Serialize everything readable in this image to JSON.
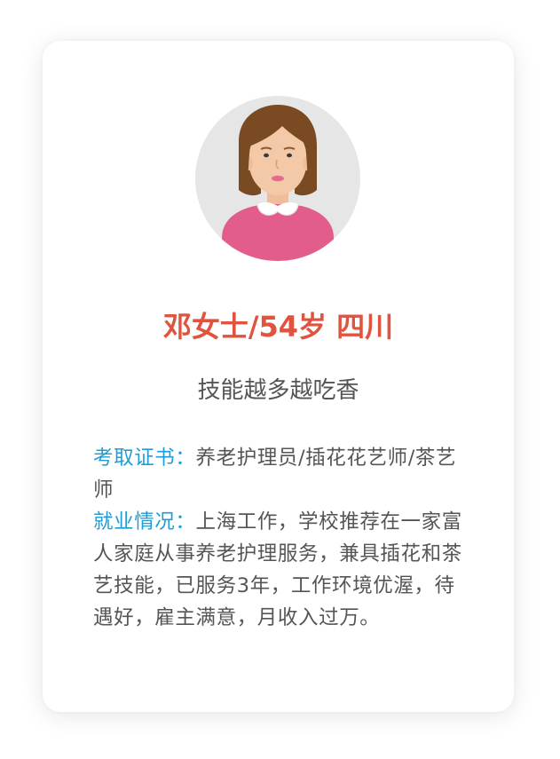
{
  "colors": {
    "name": "#e0533f",
    "subtitle": "#555555",
    "label": "#1e9ed6",
    "body": "#555555",
    "avatar_bg": "#e6e6e6",
    "hair": "#7a4a22",
    "skin": "#f3c9a8",
    "sweater": "#e25d8b",
    "collar": "#ffffff"
  },
  "profile": {
    "avatar_icon": "woman-avatar-icon",
    "name": "邓女士/54岁 四川",
    "subtitle": "技能越多越吃香"
  },
  "details": {
    "certificates_label": "考取证书：",
    "certificates_value": "养老护理员/插花花艺师/茶艺师",
    "employment_label": "就业情况：",
    "employment_value": "上海工作，学校推荐在一家富人家庭从事养老护理服务，兼具插花和茶艺技能，已服务3年，工作环境优渥，待遇好，雇主满意，月收入过万。"
  }
}
